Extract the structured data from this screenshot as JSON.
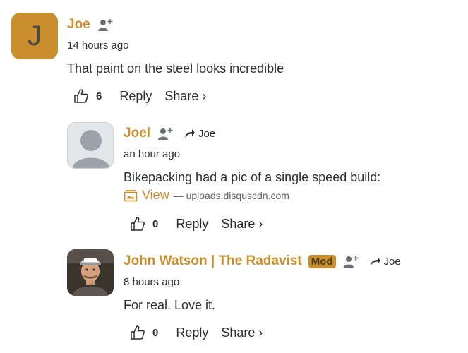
{
  "comments": [
    {
      "author": "Joe",
      "avatar_letter": "J",
      "timestamp": "14 hours ago",
      "text": "That paint on the steel looks incredible",
      "likes": "6",
      "reply_label": "Reply",
      "share_label": "Share ›"
    },
    {
      "author": "Joel",
      "reply_to": "Joe",
      "timestamp": "an hour ago",
      "text": "Bikepacking had a pic of a single speed build:",
      "attachment": {
        "view_label": "View",
        "domain": "— uploads.disquscdn.com"
      },
      "likes": "0",
      "reply_label": "Reply",
      "share_label": "Share ›"
    },
    {
      "author": "John Watson | The Radavist",
      "badge": "Mod",
      "reply_to": "Joe",
      "timestamp": "8 hours ago",
      "text": "For real. Love it.",
      "likes": "0",
      "reply_label": "Reply",
      "share_label": "Share ›"
    }
  ],
  "colors": {
    "accent": "#c98f2e",
    "text": "#2a2e2e",
    "icon": "#6b7177"
  }
}
